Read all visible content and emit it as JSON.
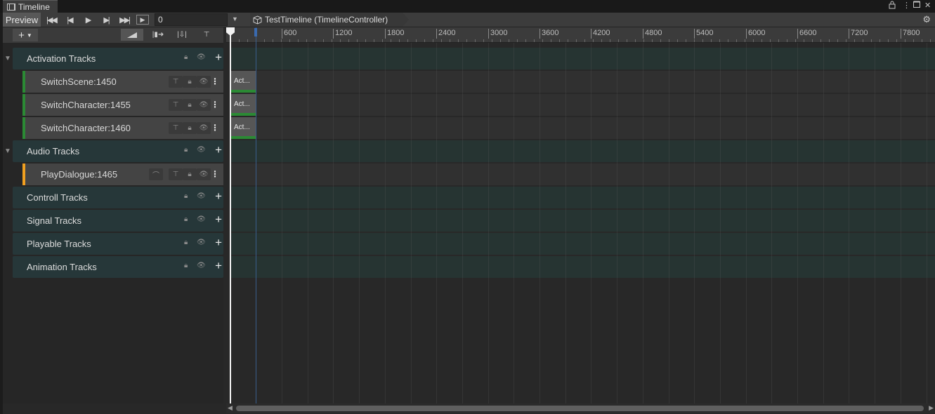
{
  "window": {
    "tab_title": "Timeline",
    "lock_icon": "lock-icon",
    "menu_icon": "menu-icon",
    "maximize_icon": "maximize-icon",
    "close_icon": "close-icon"
  },
  "toolbar": {
    "preview_label": "Preview",
    "current_frame": "0",
    "breadcrumb": "TestTimeline (TimelineController)",
    "icons": [
      "go-to-start-icon",
      "previous-frame-icon",
      "play-icon",
      "next-frame-icon",
      "go-to-end-icon",
      "play-range-icon"
    ]
  },
  "ruler": {
    "ticks": [
      "600",
      "1200",
      "1800",
      "2400",
      "3000",
      "3600",
      "4200",
      "4800",
      "5400",
      "6000",
      "6600",
      "7200",
      "7800"
    ]
  },
  "tracks": {
    "activation": {
      "label": "Activation Tracks",
      "items": [
        {
          "label": "SwitchScene:1450",
          "clip": "Act...",
          "color": "#2b8a34"
        },
        {
          "label": "SwitchCharacter:1455",
          "clip": "Act...",
          "color": "#2b8a34"
        },
        {
          "label": "SwitchCharacter:1460",
          "clip": "Act...",
          "color": "#2b8a34"
        }
      ]
    },
    "audio": {
      "label": "Audio Tracks",
      "items": [
        {
          "label": "PlayDialogue:1465",
          "color": "#f0a020"
        }
      ]
    },
    "controll": {
      "label": "Controll Tracks"
    },
    "signal": {
      "label": "Signal Tracks"
    },
    "playable": {
      "label": "Playable Tracks"
    },
    "animation": {
      "label": "Animation Tracks"
    }
  },
  "colors": {
    "group_bg": "#263739",
    "track_bg": "#444444",
    "activation_accent": "#2b8a34",
    "audio_accent": "#f0a020",
    "playhead": "#f2f2f2"
  }
}
